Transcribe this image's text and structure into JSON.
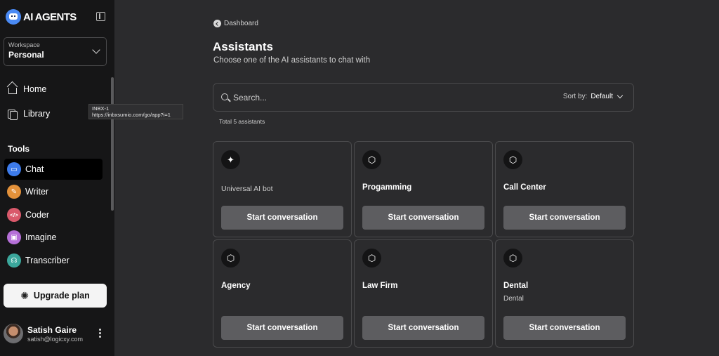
{
  "brand": {
    "name": "AI AGENTS"
  },
  "workspace": {
    "label": "Workspace",
    "value": "Personal"
  },
  "nav": [
    {
      "label": "Home",
      "icon": "home-icon"
    },
    {
      "label": "Library",
      "icon": "library-icon"
    }
  ],
  "tooltip": {
    "line1": "INBX-1",
    "line2": "https://inbxsumio.com/go/app?i=1"
  },
  "tools": {
    "title": "Tools",
    "items": [
      {
        "label": "Chat",
        "icon": "chat-icon",
        "color": "#3d7bea"
      },
      {
        "label": "Writer",
        "icon": "writer-icon",
        "color": "#e3913a"
      },
      {
        "label": "Coder",
        "icon": "coder-icon",
        "color": "#d9596b"
      },
      {
        "label": "Imagine",
        "icon": "imagine-icon",
        "color": "#b56fd8"
      },
      {
        "label": "Transcriber",
        "icon": "transcriber-icon",
        "color": "#3ba79c"
      }
    ]
  },
  "upgrade": {
    "label": "Upgrade plan"
  },
  "user": {
    "name": "Satish Gaire",
    "email": "satish@logicxy.com"
  },
  "breadcrumb": {
    "label": "Dashboard"
  },
  "page": {
    "title": "Assistants",
    "subtitle": "Choose one of the AI assistants to chat with"
  },
  "search": {
    "placeholder": "Search...",
    "sort_label": "Sort by:",
    "sort_value": "Default"
  },
  "total": "Total 5 assistants",
  "cards": [
    {
      "title": "Universal AI bot",
      "subtitle": "",
      "icon": "sparkle-icon",
      "button": "Start conversation"
    },
    {
      "title": "Progamming",
      "subtitle": "",
      "icon": "cube-icon",
      "button": "Start conversation"
    },
    {
      "title": "Call Center",
      "subtitle": "",
      "icon": "cube-icon",
      "button": "Start conversation"
    },
    {
      "title": "Agency",
      "subtitle": "",
      "icon": "cube-icon",
      "button": "Start conversation"
    },
    {
      "title": "Law Firm",
      "subtitle": "",
      "icon": "cube-icon",
      "button": "Start conversation"
    },
    {
      "title": "Dental",
      "subtitle": "Dental",
      "icon": "cube-icon",
      "button": "Start conversation"
    }
  ]
}
